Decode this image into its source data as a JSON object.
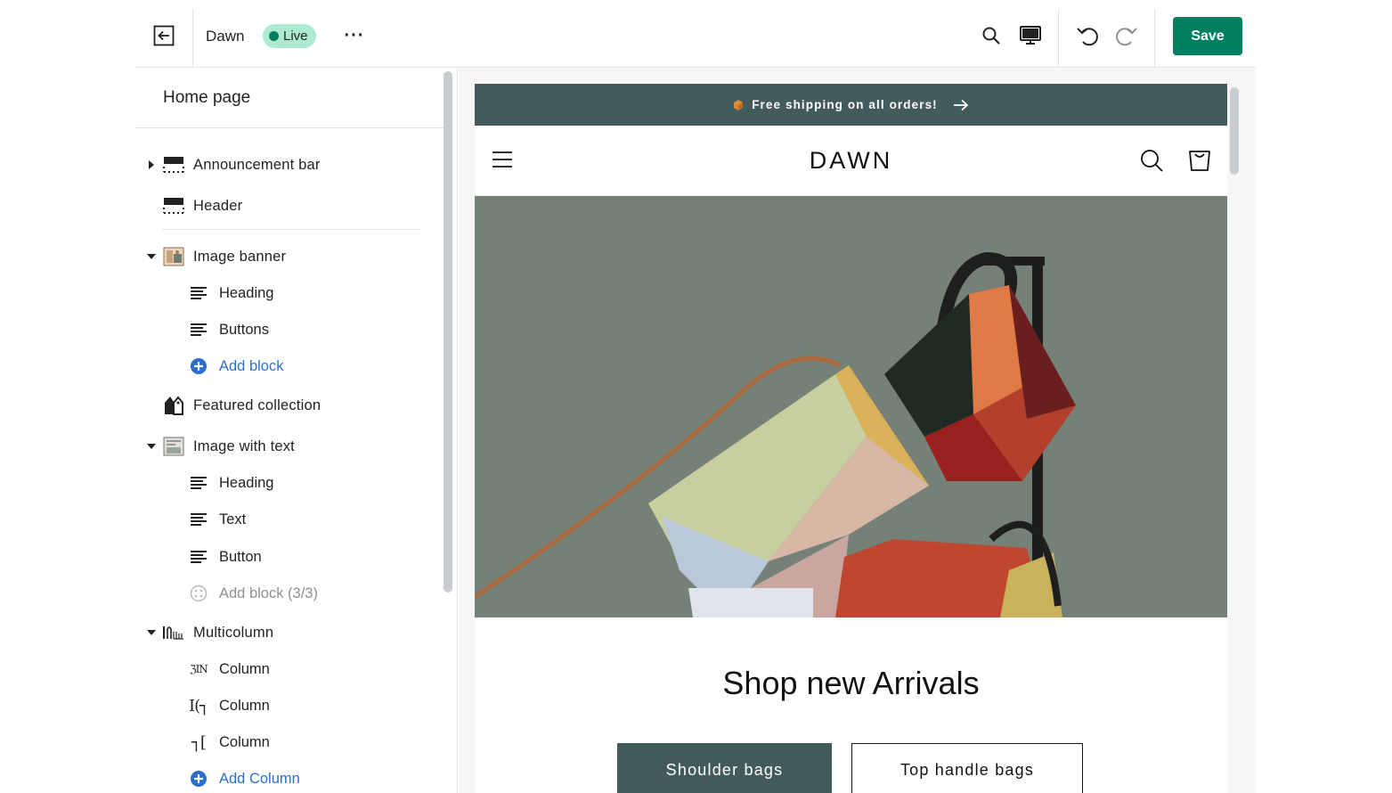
{
  "topbar": {
    "theme_name": "Dawn",
    "live_badge": "Live",
    "more_label": "···",
    "save_label": "Save"
  },
  "sidebar": {
    "title": "Home page",
    "sections": [
      {
        "label": "Announcement bar",
        "icon": "layout-header-icon",
        "expandable": true,
        "expanded": false
      },
      {
        "label": "Header",
        "icon": "layout-header-icon",
        "expandable": false
      },
      {
        "label": "Image banner",
        "icon": "image-banner-icon",
        "expandable": true,
        "expanded": true,
        "blocks": [
          {
            "label": "Heading",
            "icon": "text-block-icon"
          },
          {
            "label": "Buttons",
            "icon": "text-block-icon"
          },
          {
            "label": "Add block",
            "icon": "add-circle-icon",
            "is_add": true
          }
        ]
      },
      {
        "label": "Featured collection",
        "icon": "tag-icon",
        "expandable": false
      },
      {
        "label": "Image with text",
        "icon": "image-with-text-icon",
        "expandable": true,
        "expanded": true,
        "blocks": [
          {
            "label": "Heading",
            "icon": "text-block-icon"
          },
          {
            "label": "Text",
            "icon": "text-block-icon"
          },
          {
            "label": "Button",
            "icon": "text-block-icon"
          },
          {
            "label": "Add block (3/3)",
            "icon": "add-circle-disabled-icon",
            "is_add": true,
            "disabled": true
          }
        ]
      },
      {
        "label": "Multicolumn",
        "icon": "multicolumn-icon",
        "expandable": true,
        "expanded": true,
        "blocks": [
          {
            "label": "Column",
            "icon": "column-image-icon",
            "glyph": "ℨIN"
          },
          {
            "label": "Column",
            "icon": "column-image-icon",
            "glyph": "I(┐"
          },
          {
            "label": "Column",
            "icon": "column-image-icon",
            "glyph": "┐["
          },
          {
            "label": "Add Column",
            "icon": "add-circle-icon",
            "is_add": true
          }
        ]
      }
    ]
  },
  "preview": {
    "announcement_text": "Free shipping on all orders!",
    "logo": "DAWN",
    "banner_heading": "Shop new Arrivals",
    "button_primary": "Shoulder bags",
    "button_secondary": "Top handle bags"
  },
  "colors": {
    "primary_green": "#008060",
    "live_badge_bg": "#aee9d1",
    "announcement_bg": "#445b5b",
    "banner_bg": "#7a867b",
    "link_blue": "#2c6ecb"
  }
}
